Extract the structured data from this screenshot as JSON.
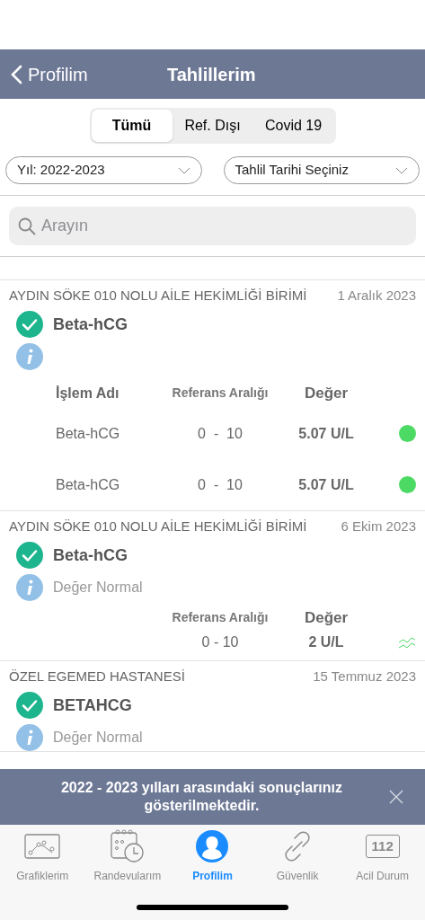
{
  "nav": {
    "back_label": "Profilim",
    "title": "Tahlillerim"
  },
  "segments": [
    {
      "label": "Tümü",
      "selected": true
    },
    {
      "label": "Ref. Dışı",
      "selected": false
    },
    {
      "label": "Covid 19",
      "selected": false
    }
  ],
  "filters": [
    {
      "value": "Yıl: 2022-2023"
    },
    {
      "value": "Tahlil Tarihi Seçiniz"
    }
  ],
  "search": {
    "placeholder": "Arayın"
  },
  "results": [
    {
      "facility": "AYDIN SÖKE 010 NOLU AİLE HEKİMLİĞİ BİRİMİ",
      "date": "1 Aralık 2023",
      "test": "Beta-hCG",
      "verified": true,
      "columns": [
        "İşlem Adı",
        "Referans Aralığı",
        "Değer"
      ],
      "rows": [
        {
          "name": "Beta-hCG",
          "range": "0  -  10",
          "value": "5.07 U/L",
          "kind": "dot",
          "color": "#4cd964"
        },
        {
          "name": "Beta-hCG",
          "range": "0  -  10",
          "value": "5.07 U/L",
          "kind": "dot",
          "color": "#4cd964"
        }
      ]
    },
    {
      "facility": "AYDIN SÖKE 010 NOLU AİLE HEKİMLİĞİ BİRİMİ",
      "date": "6 Ekim 2023",
      "test": "Beta-hCG",
      "verified": true,
      "info": "Değer Normal",
      "columns": [
        "Referans Aralığı",
        "Değer"
      ],
      "rows": [
        {
          "range": "0 - 10",
          "value": "2 U/L",
          "kind": "trend"
        }
      ]
    },
    {
      "facility": "ÖZEL EGEMED HASTANESİ",
      "date": "15 Temmuz 2023",
      "test": "BETAHCG",
      "verified": true,
      "info": "Değer Normal"
    }
  ],
  "banner": {
    "text": "2022 - 2023 yılları arasındaki sonuçlarınız gösterilmektedir."
  },
  "tab_bar": [
    {
      "label": "Grafiklerim",
      "kind": "chart",
      "selected": false
    },
    {
      "label": "Randevularım",
      "kind": "calendar",
      "selected": false
    },
    {
      "label": "Profilim",
      "kind": "profile",
      "selected": true
    },
    {
      "label": "Güvenlik",
      "kind": "link",
      "selected": false
    },
    {
      "label": "Acil Durum",
      "kind": "emergency",
      "selected": false,
      "icon_text": "112"
    }
  ]
}
